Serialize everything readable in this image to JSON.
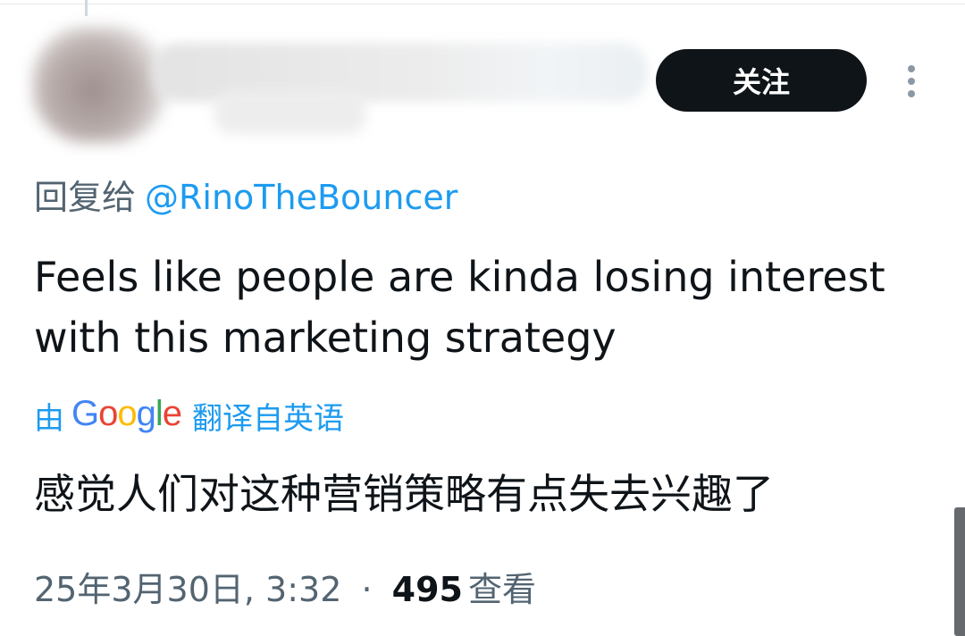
{
  "header": {
    "follow_label": "关注"
  },
  "tweet": {
    "reply_prefix": "回复给",
    "reply_mention": "@RinoTheBouncer",
    "text": "Feels like people are kinda losing interest with this marketing strategy",
    "translation_prefix": "由",
    "translation_provider": "Google",
    "translation_suffix": "翻译自英语",
    "translated_text": "感觉人们对这种营销策略有点失去兴趣了",
    "timestamp": "25年3月30日, 3:32",
    "separator": "·",
    "views_count": "495",
    "views_label": "查看"
  },
  "colors": {
    "accent": "#1d9bf0",
    "text_primary": "#0f1419",
    "text_secondary": "#536471",
    "button_bg": "#0f1419"
  },
  "icons": {
    "more": "more-vertical-icon"
  }
}
